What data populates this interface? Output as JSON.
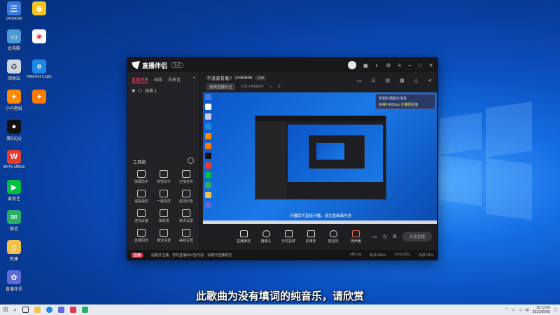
{
  "desktop": {
    "icons": [
      {
        "label": "2436696",
        "color": "#3b7be0"
      },
      {
        "label": "此电脑",
        "color": "#4b9ad6"
      },
      {
        "label": "回收站",
        "color": "#d8d8d8"
      },
      {
        "label": "Internet Explorer",
        "color": "#1e88e5"
      },
      {
        "label": "小鸟壁纸",
        "color": "#ff8a00"
      },
      {
        "label": "腾讯QQ",
        "color": "#111111"
      },
      {
        "label": "WPS Office",
        "color": "#e63a2e"
      },
      {
        "label": "爱奇艺",
        "color": "#00c040"
      },
      {
        "label": "微信",
        "color": "#2aae67"
      },
      {
        "label": "新建",
        "color": "#f3c24d"
      },
      {
        "label": "直播伴侣",
        "color": "#5c6bd8"
      }
    ]
  },
  "app": {
    "logo_text": "直播伴侣",
    "version_badge": "5.2",
    "sidebar": {
      "tabs": [
        "直播场景",
        "画面",
        "背景音"
      ],
      "scene_label": "场景 1",
      "tools_title": "工具箱",
      "tools": [
        "弹幕助手",
        "房管助手",
        "主播任务",
        "福袋抽奖",
        "一键投屏",
        "虚拟形象",
        "连线设置",
        "弹幕墙",
        "歌词设置",
        "直播回放",
        "推流设置",
        "美颜设置"
      ]
    },
    "room": {
      "title": "不浪者有着?",
      "id": "2436696",
      "badge": "待审",
      "category": "选择直播分区",
      "cid": "CID 2436696",
      "likes": "0"
    },
    "preview": {
      "gift_line1": "收到礼物提示消息",
      "gift_line2": "获得1000Exp 主播经验值",
      "caption": "开播后可直接开播，请注意画面内容"
    },
    "controls": [
      {
        "label": "直播推流"
      },
      {
        "label": "摄像头"
      },
      {
        "label": "手机投屏"
      },
      {
        "label": "多媒体"
      },
      {
        "label": "麦克风"
      },
      {
        "label": "扬声器"
      }
    ],
    "start_button": "开始直播",
    "status": {
      "live_tag": "直播",
      "notice": "提醒开主播，您的直播间公告内容，请遵守直播规范",
      "fps": "FPS:30",
      "bitrate": "码率:0kb/s",
      "cpu": "CPU:33%",
      "mem": "内存:33%"
    }
  },
  "subtitle": "此歌曲为没有填词的纯音乐，请欣赏",
  "taskbar": {
    "time": "20:12:00",
    "date": "2021/09/08",
    "lang": "中"
  }
}
